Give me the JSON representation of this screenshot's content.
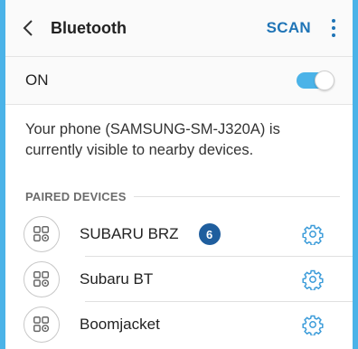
{
  "header": {
    "title": "Bluetooth",
    "scan_label": "SCAN"
  },
  "toggle": {
    "label": "ON",
    "state": true
  },
  "info_text": "Your phone (SAMSUNG-SM-J320A) is currently visible to nearby devices.",
  "paired": {
    "section_label": "PAIRED DEVICES",
    "devices": [
      {
        "name": "SUBARU BRZ",
        "badge": "6"
      },
      {
        "name": "Subaru BT"
      },
      {
        "name": "Boomjacket"
      }
    ]
  },
  "colors": {
    "accent": "#1f74b6",
    "toggle_on": "#4bb3e8",
    "badge": "#1f5e9e"
  },
  "icons": [
    "back-chevron-icon",
    "more-vert-icon",
    "device-icon",
    "gear-icon"
  ]
}
